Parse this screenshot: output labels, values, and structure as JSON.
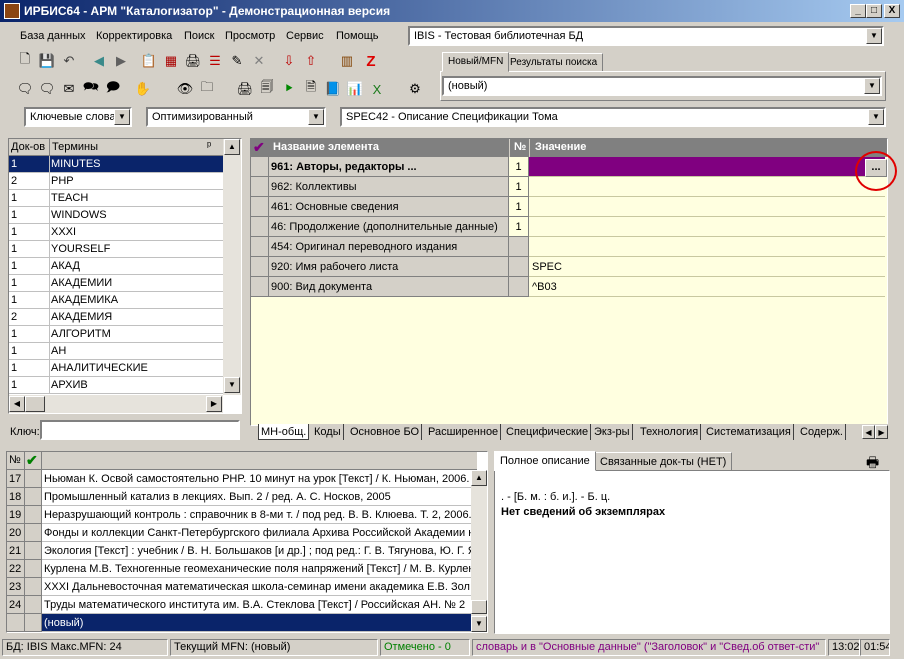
{
  "window": {
    "title": "ИРБИС64 - АРМ \"Каталогизатор\" - Демонстрационная версия",
    "minimize": "_",
    "maximize": "□",
    "close": "X"
  },
  "menu": [
    "База данных",
    "Корректировка",
    "Поиск",
    "Просмотр",
    "Сервис",
    "Помощь"
  ],
  "database_select": "IBIS - Тестовая библиотечная БД",
  "record_tabs": [
    "Новый/MFN",
    "Результаты поиска"
  ],
  "record_select": "(новый)",
  "filters": {
    "dictionary": "Ключевые слова",
    "mode": "Оптимизированный",
    "worksheet": "SPEC42 - Описание Спецификации Тома"
  },
  "dictionary": {
    "headers": {
      "docs": "Док-ов",
      "terms": "Термины"
    },
    "rows": [
      {
        "docs": "1",
        "term": "MINUTES"
      },
      {
        "docs": "2",
        "term": "PHP"
      },
      {
        "docs": "1",
        "term": "TEACH"
      },
      {
        "docs": "1",
        "term": "WINDOWS"
      },
      {
        "docs": "1",
        "term": "XXXI"
      },
      {
        "docs": "1",
        "term": "YOURSELF"
      },
      {
        "docs": "1",
        "term": "АКАД"
      },
      {
        "docs": "1",
        "term": "АКАДЕМИИ"
      },
      {
        "docs": "1",
        "term": "АКАДЕМИКА"
      },
      {
        "docs": "2",
        "term": "АКАДЕМИЯ"
      },
      {
        "docs": "1",
        "term": "АЛГОРИТМ"
      },
      {
        "docs": "1",
        "term": "АН"
      },
      {
        "docs": "1",
        "term": "АНАЛИТИЧЕСКИЕ"
      },
      {
        "docs": "1",
        "term": "АРХИВ"
      }
    ],
    "key_label": "Ключ:",
    "key_value": ""
  },
  "editor": {
    "headers": {
      "name": "Название элемента",
      "num": "№",
      "value": "Значение"
    },
    "rows": [
      {
        "name": "961: Авторы, редакторы ...",
        "num": "1",
        "value": ""
      },
      {
        "name": "962: Коллективы",
        "num": "1",
        "value": ""
      },
      {
        "name": "461: Основные сведения",
        "num": "1",
        "value": ""
      },
      {
        "name": "46: Продолжение (дополнительные данные)",
        "num": "1",
        "value": ""
      },
      {
        "name": "454: Оригинал переводного издания",
        "num": "",
        "value": ""
      },
      {
        "name": "920: Имя рабочего листа",
        "num": "",
        "value": "SPEC"
      },
      {
        "name": "900: Вид документа",
        "num": "",
        "value": "^B03"
      }
    ],
    "ellipsis_button": "...",
    "bottom_tabs": [
      "МН-общ.",
      "Коды",
      "Основное БО",
      "Расширенное",
      "Специфические",
      "Экз-ры",
      "Технология",
      "Систематизация",
      "Содерж."
    ]
  },
  "documents": {
    "header_num": "№",
    "rows": [
      {
        "num": "17",
        "text": "Ньюман К. Освой самостоятельно PHP. 10 минут на урок [Текст] / К. Ньюман, 2006."
      },
      {
        "num": "18",
        "text": "Промышленный катализ в лекциях. Вып. 2 / ред. А. С. Носков, 2005"
      },
      {
        "num": "19",
        "text": "Неразрушающий контроль : справочник в 8-ми т. / под ред. В. В. Клюева. Т. 2, 2006."
      },
      {
        "num": "20",
        "text": "Фонды и коллекции Санкт-Петербургского филиала Архива Российской Академии н"
      },
      {
        "num": "21",
        "text": "Экология [Текст] : учебник / В. Н. Большаков [и др.] ; под ред.: Г. В. Тягунова, Ю. Г. Я"
      },
      {
        "num": "22",
        "text": "Курлена М.В. Техногенные геомеханические поля напряжений [Текст] / М. В. Курлен"
      },
      {
        "num": "23",
        "text": "XXXI Дальневосточная математическая школа-семинар имени академика Е.В. Зол"
      },
      {
        "num": "24",
        "text": "Труды математического института им. В.А. Стеклова [Текст] / Российская АН. № 2"
      },
      {
        "num": "",
        "text": "(новый)"
      }
    ]
  },
  "preview": {
    "tabs": [
      "Полное описание",
      "Связанные док-ты (НЕТ)"
    ],
    "line1": ". - [Б. м. : б. и.]. - Б. ц.",
    "line2": "Нет сведений об экземплярах"
  },
  "status": {
    "db": "БД: IBIS Макс.MFN: 24",
    "current": "Текущий MFN: (новый)",
    "marked": "Отмечено - 0",
    "hint": "словарь и в \"Основные данные\" (\"Заголовок\" и \"Свед.об ответ-сти\"",
    "time1": "13:02",
    "time2": "01:54"
  },
  "colors": {
    "selection": "#0a246a",
    "selected_field": "#800080",
    "value_bg": "#ffffe0",
    "marked": "#008000",
    "hint": "#800080"
  }
}
